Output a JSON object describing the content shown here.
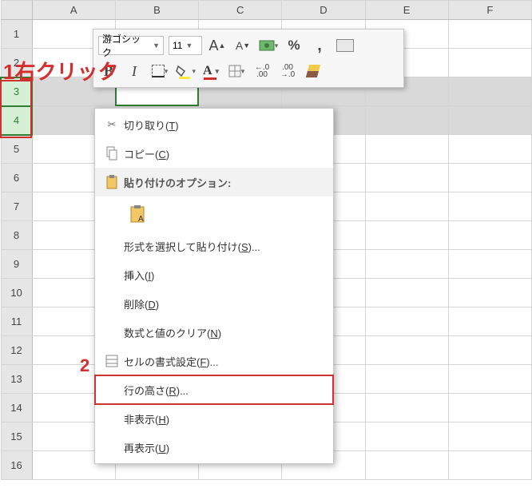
{
  "columns": [
    "A",
    "B",
    "C",
    "D",
    "E",
    "F"
  ],
  "rows": [
    "1",
    "2",
    "3",
    "4",
    "5",
    "6",
    "7",
    "8",
    "9",
    "10",
    "11",
    "12",
    "13",
    "14",
    "15",
    "16"
  ],
  "selected_rows": [
    3,
    4
  ],
  "active_cell": "B3",
  "minitoolbar": {
    "font_name": "游ゴシック",
    "font_size": "11",
    "buttons": {
      "grow_font": "A",
      "shrink_font": "A",
      "percent": "%",
      "comma": ",",
      "bold": "B",
      "italic": "I",
      "font_color_glyph": "A",
      "inc_dec_label1": ".00",
      "inc_dec_label2": ".0"
    }
  },
  "contextmenu": {
    "cut": "切り取り(T)",
    "copy": "コピー(C)",
    "paste_header": "貼り付けのオプション:",
    "paste_special": "形式を選択して貼り付け(S)...",
    "insert": "挿入(I)",
    "delete": "削除(D)",
    "clear": "数式と値のクリア(N)",
    "format_cells": "セルの書式設定(F)...",
    "row_height": "行の高さ(R)...",
    "hide": "非表示(H)",
    "unhide": "再表示(U)"
  },
  "annotations": {
    "a1": "1右クリック",
    "a2": "2"
  }
}
